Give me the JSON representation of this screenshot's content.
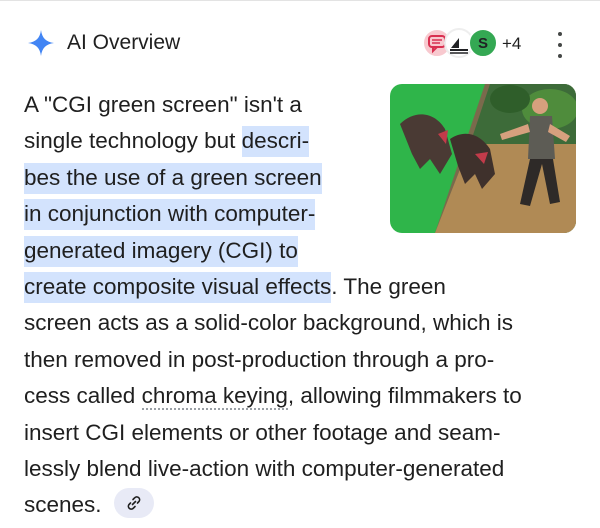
{
  "header": {
    "title": "AI Overview",
    "source_s_letter": "S",
    "more_sources": "+4",
    "sparkle_color": "#4285f4"
  },
  "body": {
    "line1": "A \"CGI green screen\" isn't a",
    "line2_plain": "single technology but ",
    "line2_hl": "descri-",
    "line3_hl": "bes the use of a green screen",
    "line4_hl": "in conjunction with computer-",
    "line5_hl": "generated imagery (CGI) to",
    "line6_hl": "create composite visual effects",
    "line6_plain": ". The green",
    "line7": "screen acts as a solid-color background, which is",
    "line8": "then removed in post-production through a pro-",
    "line9_pre": "cess called ",
    "line9_link": "chroma keying",
    "line9_post": ", allowing filmmakers to",
    "line10": "insert CGI elements or other footage and seam-",
    "line11": "lessly blend live-action with computer-generated",
    "line12": "scenes."
  },
  "colors": {
    "highlight": "#d3e3fd",
    "green_screen": "#2fb54a",
    "text": "#1f1f1f"
  }
}
